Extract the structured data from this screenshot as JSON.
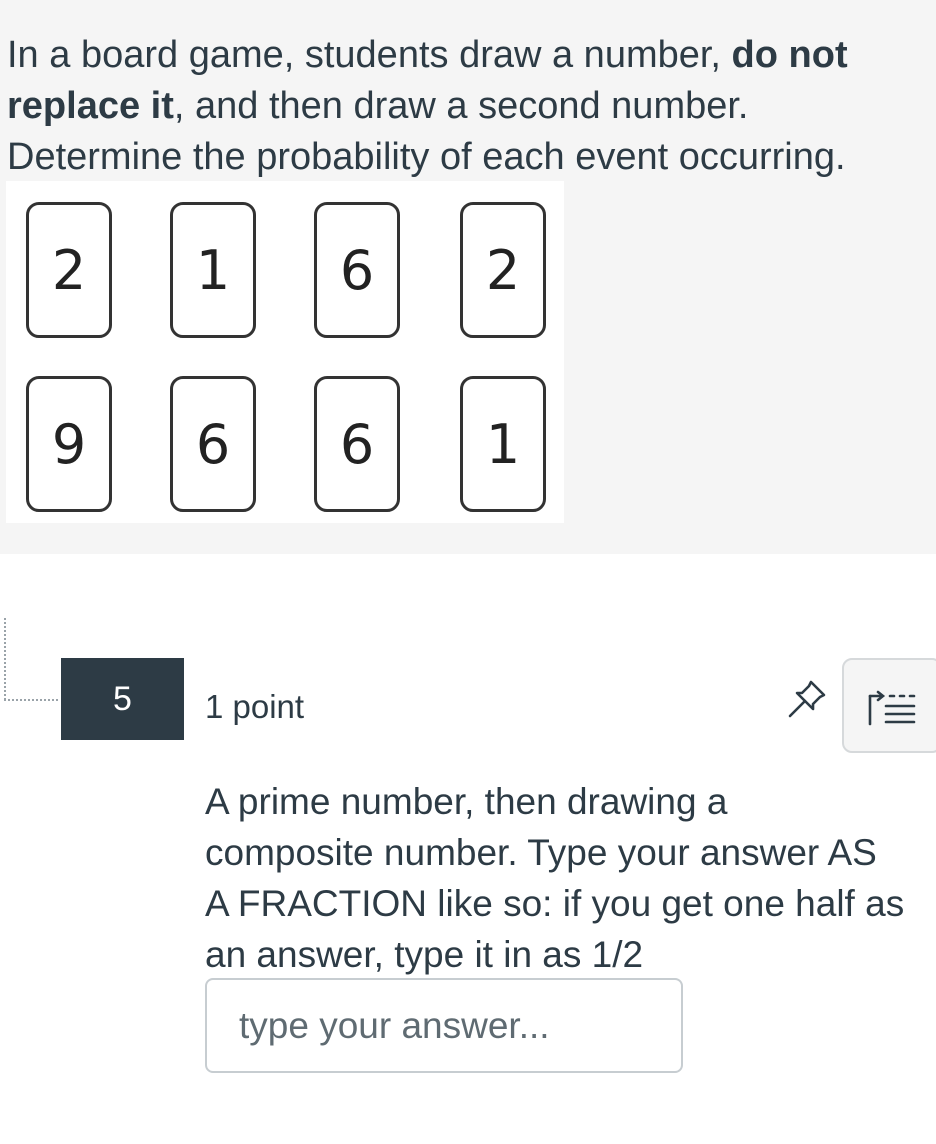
{
  "intro": {
    "part1": "In a board game, students draw a number, ",
    "bold1": "do not replace it",
    "part2": ", and then draw a second number. Determine the probability of each event occurring."
  },
  "cards": [
    "2",
    "1",
    "6",
    "2",
    "9",
    "6",
    "6",
    "1"
  ],
  "question": {
    "number": "5",
    "points": "1 point",
    "text": "A prime number, then drawing a composite number.  Type your answer AS A FRACTION like so: if you get one half as an answer, type it in as 1/2",
    "placeholder": "type your answer...",
    "value": ""
  },
  "icons": {
    "pin": "pin-icon",
    "list": "question-list-icon"
  },
  "colors": {
    "question_badge": "#2d3b45",
    "text": "#2d3b45"
  }
}
